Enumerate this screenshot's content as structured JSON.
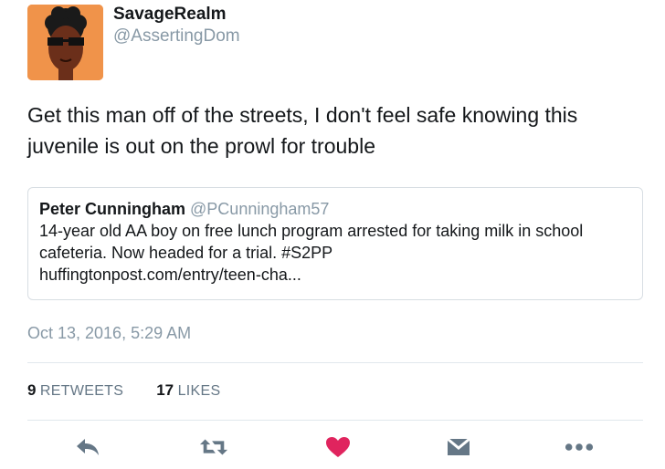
{
  "author": {
    "display_name": "SavageRealm",
    "handle": "@AssertingDom"
  },
  "tweet": {
    "text": "Get this man off of the streets, I don't feel safe knowing this juvenile is out on the prowl for trouble",
    "timestamp": "Oct 13, 2016, 5:29 AM"
  },
  "quoted_tweet": {
    "display_name": "Peter Cunningham",
    "handle": "@PCunningham57",
    "text_line1": "14-year old AA boy on free lunch program arrested for taking milk in school",
    "text_line2": "cafeteria. Now headed for a trial. #S2PP",
    "link": "huffingtonpost.com/entry/teen-cha..."
  },
  "stats": {
    "retweets_count": "9",
    "retweets_label": "RETWEETS",
    "likes_count": "17",
    "likes_label": "LIKES"
  },
  "actions": {
    "reply_icon": "reply-icon",
    "retweet_icon": "retweet-icon",
    "like_icon": "heart-icon",
    "message_icon": "direct-message-icon",
    "more_icon": "more-icon"
  },
  "colors": {
    "text": "#14171a",
    "secondary": "#8899a6",
    "icon": "#657786",
    "like": "#e0245e",
    "avatar_bg": "#f0934a"
  }
}
